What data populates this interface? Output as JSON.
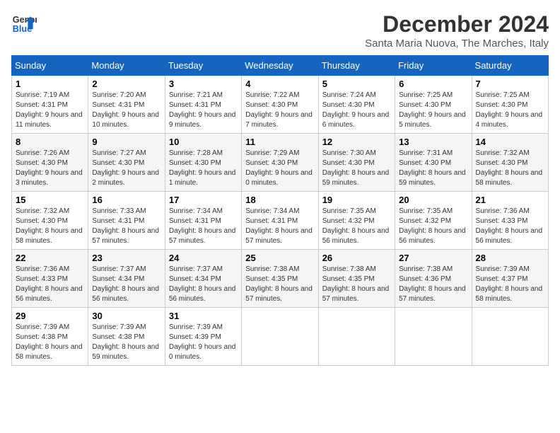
{
  "header": {
    "logo_line1": "General",
    "logo_line2": "Blue",
    "month_title": "December 2024",
    "location": "Santa Maria Nuova, The Marches, Italy"
  },
  "weekdays": [
    "Sunday",
    "Monday",
    "Tuesday",
    "Wednesday",
    "Thursday",
    "Friday",
    "Saturday"
  ],
  "weeks": [
    [
      {
        "day": "1",
        "sunrise": "7:19 AM",
        "sunset": "4:31 PM",
        "daylight": "9 hours and 11 minutes."
      },
      {
        "day": "2",
        "sunrise": "7:20 AM",
        "sunset": "4:31 PM",
        "daylight": "9 hours and 10 minutes."
      },
      {
        "day": "3",
        "sunrise": "7:21 AM",
        "sunset": "4:31 PM",
        "daylight": "9 hours and 9 minutes."
      },
      {
        "day": "4",
        "sunrise": "7:22 AM",
        "sunset": "4:30 PM",
        "daylight": "9 hours and 7 minutes."
      },
      {
        "day": "5",
        "sunrise": "7:24 AM",
        "sunset": "4:30 PM",
        "daylight": "9 hours and 6 minutes."
      },
      {
        "day": "6",
        "sunrise": "7:25 AM",
        "sunset": "4:30 PM",
        "daylight": "9 hours and 5 minutes."
      },
      {
        "day": "7",
        "sunrise": "7:25 AM",
        "sunset": "4:30 PM",
        "daylight": "9 hours and 4 minutes."
      }
    ],
    [
      {
        "day": "8",
        "sunrise": "7:26 AM",
        "sunset": "4:30 PM",
        "daylight": "9 hours and 3 minutes."
      },
      {
        "day": "9",
        "sunrise": "7:27 AM",
        "sunset": "4:30 PM",
        "daylight": "9 hours and 2 minutes."
      },
      {
        "day": "10",
        "sunrise": "7:28 AM",
        "sunset": "4:30 PM",
        "daylight": "9 hours and 1 minute."
      },
      {
        "day": "11",
        "sunrise": "7:29 AM",
        "sunset": "4:30 PM",
        "daylight": "9 hours and 0 minutes."
      },
      {
        "day": "12",
        "sunrise": "7:30 AM",
        "sunset": "4:30 PM",
        "daylight": "8 hours and 59 minutes."
      },
      {
        "day": "13",
        "sunrise": "7:31 AM",
        "sunset": "4:30 PM",
        "daylight": "8 hours and 59 minutes."
      },
      {
        "day": "14",
        "sunrise": "7:32 AM",
        "sunset": "4:30 PM",
        "daylight": "8 hours and 58 minutes."
      }
    ],
    [
      {
        "day": "15",
        "sunrise": "7:32 AM",
        "sunset": "4:30 PM",
        "daylight": "8 hours and 58 minutes."
      },
      {
        "day": "16",
        "sunrise": "7:33 AM",
        "sunset": "4:31 PM",
        "daylight": "8 hours and 57 minutes."
      },
      {
        "day": "17",
        "sunrise": "7:34 AM",
        "sunset": "4:31 PM",
        "daylight": "8 hours and 57 minutes."
      },
      {
        "day": "18",
        "sunrise": "7:34 AM",
        "sunset": "4:31 PM",
        "daylight": "8 hours and 57 minutes."
      },
      {
        "day": "19",
        "sunrise": "7:35 AM",
        "sunset": "4:32 PM",
        "daylight": "8 hours and 56 minutes."
      },
      {
        "day": "20",
        "sunrise": "7:35 AM",
        "sunset": "4:32 PM",
        "daylight": "8 hours and 56 minutes."
      },
      {
        "day": "21",
        "sunrise": "7:36 AM",
        "sunset": "4:33 PM",
        "daylight": "8 hours and 56 minutes."
      }
    ],
    [
      {
        "day": "22",
        "sunrise": "7:36 AM",
        "sunset": "4:33 PM",
        "daylight": "8 hours and 56 minutes."
      },
      {
        "day": "23",
        "sunrise": "7:37 AM",
        "sunset": "4:34 PM",
        "daylight": "8 hours and 56 minutes."
      },
      {
        "day": "24",
        "sunrise": "7:37 AM",
        "sunset": "4:34 PM",
        "daylight": "8 hours and 56 minutes."
      },
      {
        "day": "25",
        "sunrise": "7:38 AM",
        "sunset": "4:35 PM",
        "daylight": "8 hours and 57 minutes."
      },
      {
        "day": "26",
        "sunrise": "7:38 AM",
        "sunset": "4:35 PM",
        "daylight": "8 hours and 57 minutes."
      },
      {
        "day": "27",
        "sunrise": "7:38 AM",
        "sunset": "4:36 PM",
        "daylight": "8 hours and 57 minutes."
      },
      {
        "day": "28",
        "sunrise": "7:39 AM",
        "sunset": "4:37 PM",
        "daylight": "8 hours and 58 minutes."
      }
    ],
    [
      {
        "day": "29",
        "sunrise": "7:39 AM",
        "sunset": "4:38 PM",
        "daylight": "8 hours and 58 minutes."
      },
      {
        "day": "30",
        "sunrise": "7:39 AM",
        "sunset": "4:38 PM",
        "daylight": "8 hours and 59 minutes."
      },
      {
        "day": "31",
        "sunrise": "7:39 AM",
        "sunset": "4:39 PM",
        "daylight": "9 hours and 0 minutes."
      },
      null,
      null,
      null,
      null
    ]
  ]
}
